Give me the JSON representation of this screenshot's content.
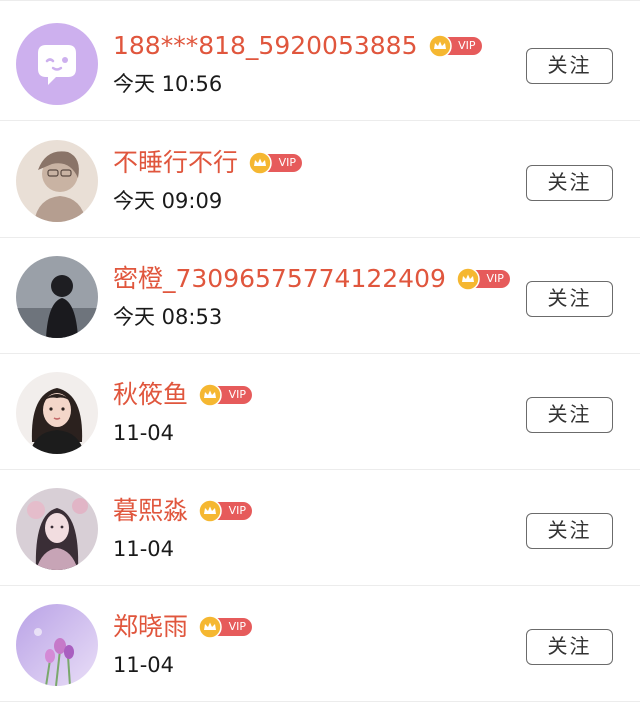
{
  "users": [
    {
      "name": "188***818_5920053885",
      "badge": "VIP",
      "time": "今天 10:56",
      "button": "关注",
      "avatar": "default-avatar-icon"
    },
    {
      "name": "不睡行不行",
      "badge": "VIP",
      "time": "今天 09:09",
      "button": "关注",
      "avatar": "user-photo-avatar"
    },
    {
      "name": "密橙_73096575774122409",
      "badge": "VIP",
      "time": "今天 08:53",
      "button": "关注",
      "avatar": "user-photo-avatar"
    },
    {
      "name": "秋筱鱼",
      "badge": "VIP",
      "time": "11-04",
      "button": "关注",
      "avatar": "user-photo-avatar"
    },
    {
      "name": "暮熙淼",
      "badge": "VIP",
      "time": "11-04",
      "button": "关注",
      "avatar": "user-photo-avatar"
    },
    {
      "name": "郑晓雨",
      "badge": "VIP",
      "time": "11-04",
      "button": "关注",
      "avatar": "user-photo-avatar"
    }
  ],
  "colors": {
    "name": "#e0563d",
    "vip_pill": "#e65b5b",
    "crown": "#f5b731",
    "divider": "#ececec",
    "button_border": "#6b6b6b"
  }
}
